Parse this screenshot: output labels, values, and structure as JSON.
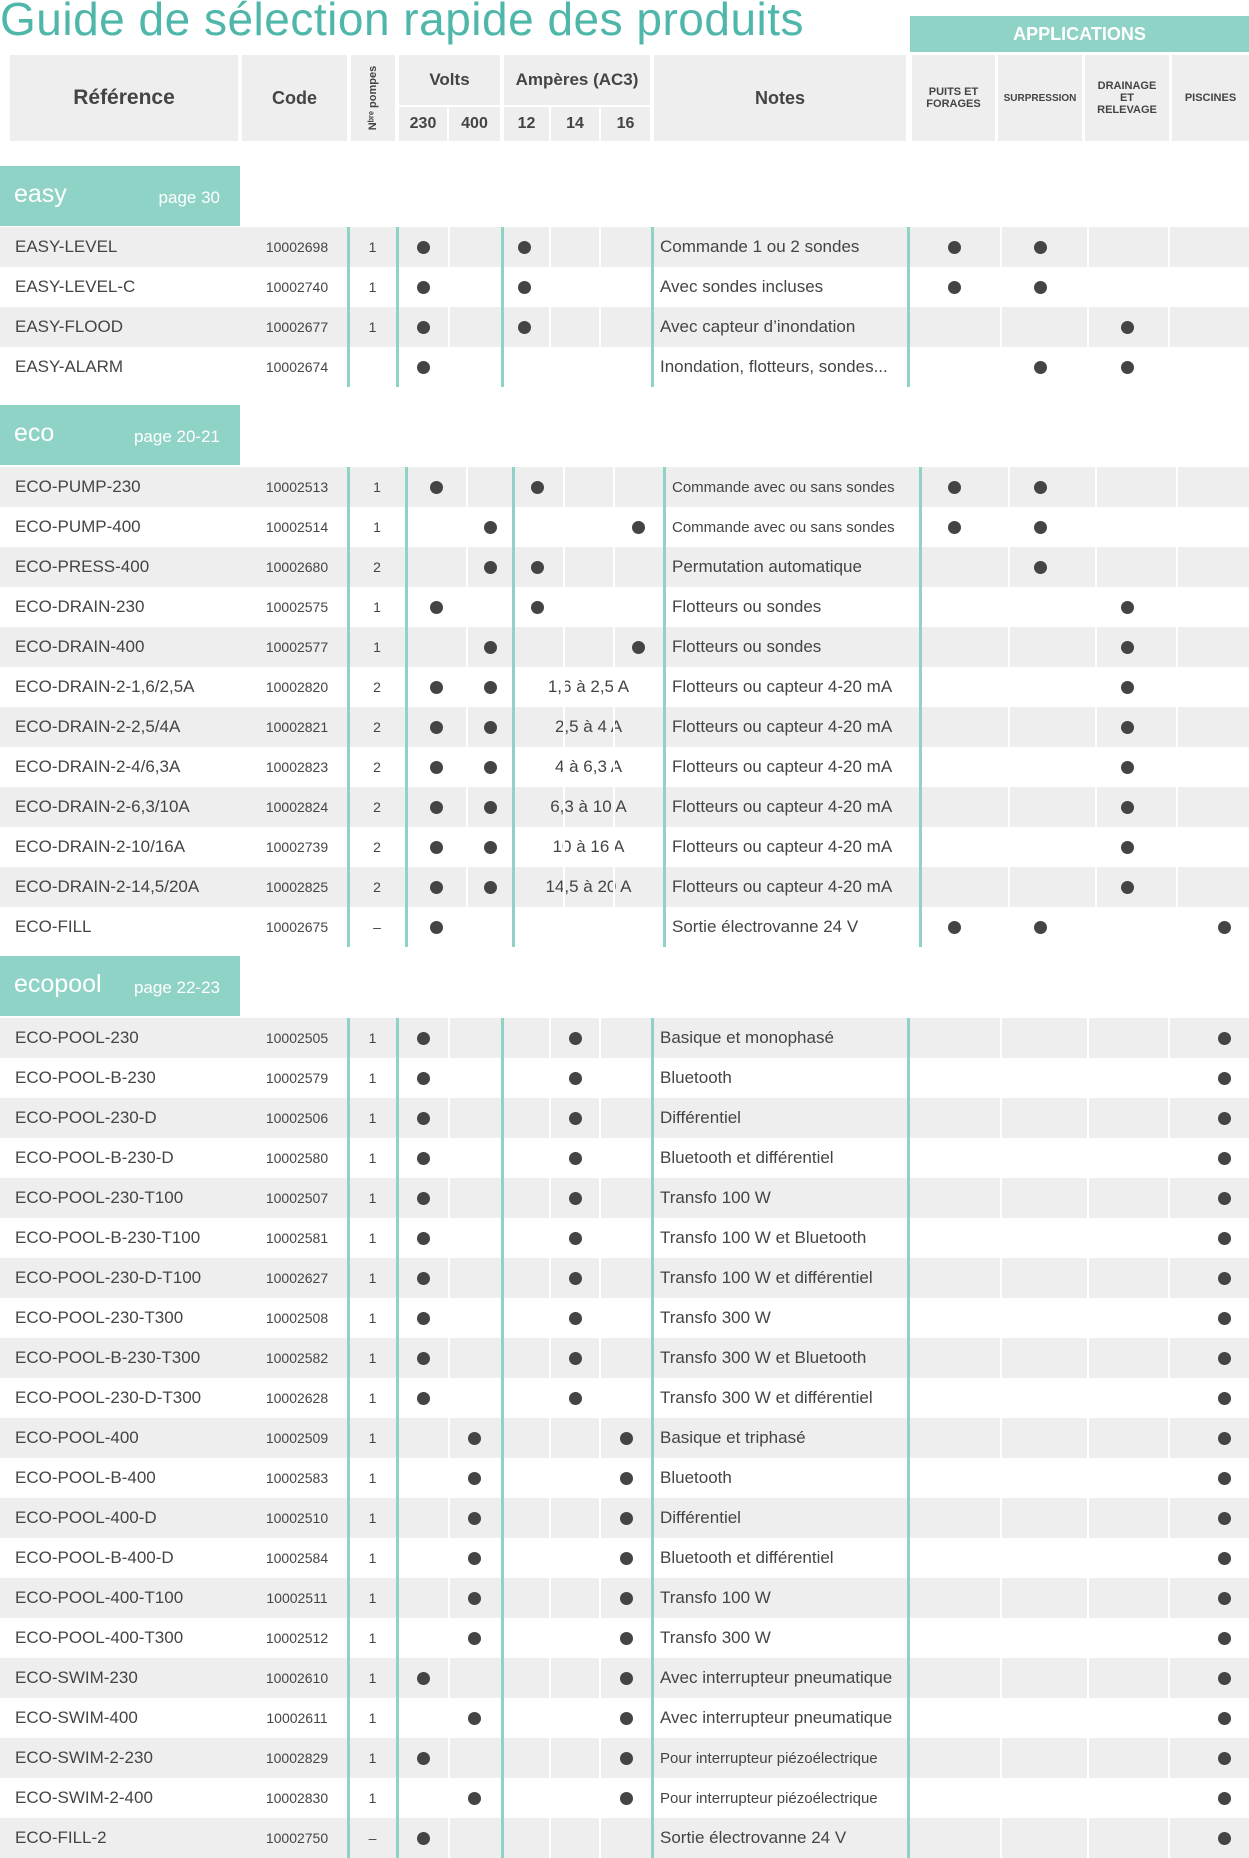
{
  "title": "Guide de sélection rapide des produits",
  "applications_label": "APPLICATIONS",
  "header": {
    "reference": "Référence",
    "code": "Code",
    "pumps": "Nᵇʳᵉ pompes",
    "volts": "Volts",
    "volts_230": "230",
    "volts_400": "400",
    "amperes": "Ampères (AC3)",
    "amp_12": "12",
    "amp_14": "14",
    "amp_16": "16",
    "notes": "Notes",
    "app_wells": "PUITS ET FORAGES",
    "app_boost": "SURPRESSION",
    "app_drain": "DRAINAGE ET RELEVAGE",
    "app_pool": "PISCINES"
  },
  "sections": [
    {
      "name": "easy",
      "page": "page 30",
      "rows": [
        {
          "ref": "EASY-LEVEL",
          "code": "10002698",
          "pumps": "1",
          "v230": true,
          "v400": false,
          "a12": true,
          "a14": false,
          "a16": false,
          "amp_range": "",
          "note": "Commande 1 ou 2 sondes",
          "apps": [
            true,
            true,
            false,
            false
          ]
        },
        {
          "ref": "EASY-LEVEL-C",
          "code": "10002740",
          "pumps": "1",
          "v230": true,
          "v400": false,
          "a12": true,
          "a14": false,
          "a16": false,
          "amp_range": "",
          "note": "Avec sondes incluses",
          "apps": [
            true,
            true,
            false,
            false
          ]
        },
        {
          "ref": "EASY-FLOOD",
          "code": "10002677",
          "pumps": "1",
          "v230": true,
          "v400": false,
          "a12": true,
          "a14": false,
          "a16": false,
          "amp_range": "",
          "note": "Avec capteur d’inondation",
          "apps": [
            false,
            false,
            true,
            false
          ]
        },
        {
          "ref": "EASY-ALARM",
          "code": "10002674",
          "pumps": "",
          "v230": true,
          "v400": false,
          "a12": false,
          "a14": false,
          "a16": false,
          "amp_range": "",
          "note": "Inondation, flotteurs, sondes...",
          "apps": [
            false,
            true,
            true,
            false
          ]
        }
      ]
    },
    {
      "name": "eco",
      "page": "page 20-21",
      "rows": [
        {
          "ref": "ECO-PUMP-230",
          "code": "10002513",
          "pumps": "1",
          "v230": true,
          "v400": false,
          "a12": true,
          "a14": false,
          "a16": false,
          "amp_range": "",
          "note": "Commande avec ou sans sondes",
          "note_small": true,
          "apps": [
            true,
            true,
            false,
            false
          ]
        },
        {
          "ref": "ECO-PUMP-400",
          "code": "10002514",
          "pumps": "1",
          "v230": false,
          "v400": true,
          "a12": false,
          "a14": false,
          "a16": true,
          "amp_range": "",
          "note": "Commande avec ou sans sondes",
          "note_small": true,
          "apps": [
            true,
            true,
            false,
            false
          ]
        },
        {
          "ref": "ECO-PRESS-400",
          "code": "10002680",
          "pumps": "2",
          "v230": false,
          "v400": true,
          "a12": true,
          "a14": false,
          "a16": false,
          "amp_range": "",
          "note": "Permutation automatique",
          "apps": [
            false,
            true,
            false,
            false
          ]
        },
        {
          "ref": "ECO-DRAIN-230",
          "code": "10002575",
          "pumps": "1",
          "v230": true,
          "v400": false,
          "a12": true,
          "a14": false,
          "a16": false,
          "amp_range": "",
          "note": "Flotteurs ou sondes",
          "apps": [
            false,
            false,
            true,
            false
          ]
        },
        {
          "ref": "ECO-DRAIN-400",
          "code": "10002577",
          "pumps": "1",
          "v230": false,
          "v400": true,
          "a12": false,
          "a14": false,
          "a16": true,
          "amp_range": "",
          "note": "Flotteurs ou sondes",
          "apps": [
            false,
            false,
            true,
            false
          ]
        },
        {
          "ref": "ECO-DRAIN-2-1,6/2,5A",
          "code": "10002820",
          "pumps": "2",
          "v230": true,
          "v400": true,
          "a12": false,
          "a14": false,
          "a16": false,
          "amp_range": "1,6 à 2,5 A",
          "note": "Flotteurs ou capteur 4-20 mA",
          "apps": [
            false,
            false,
            true,
            false
          ]
        },
        {
          "ref": "ECO-DRAIN-2-2,5/4A",
          "code": "10002821",
          "pumps": "2",
          "v230": true,
          "v400": true,
          "a12": false,
          "a14": false,
          "a16": false,
          "amp_range": "2,5 à 4 A",
          "note": "Flotteurs ou capteur 4-20 mA",
          "apps": [
            false,
            false,
            true,
            false
          ]
        },
        {
          "ref": "ECO-DRAIN-2-4/6,3A",
          "code": "10002823",
          "pumps": "2",
          "v230": true,
          "v400": true,
          "a12": false,
          "a14": false,
          "a16": false,
          "amp_range": "4 à 6,3 A",
          "note": "Flotteurs ou capteur 4-20 mA",
          "apps": [
            false,
            false,
            true,
            false
          ]
        },
        {
          "ref": "ECO-DRAIN-2-6,3/10A",
          "code": "10002824",
          "pumps": "2",
          "v230": true,
          "v400": true,
          "a12": false,
          "a14": false,
          "a16": false,
          "amp_range": "6,3 à 10 A",
          "note": "Flotteurs ou capteur 4-20 mA",
          "apps": [
            false,
            false,
            true,
            false
          ]
        },
        {
          "ref": "ECO-DRAIN-2-10/16A",
          "code": "10002739",
          "pumps": "2",
          "v230": true,
          "v400": true,
          "a12": false,
          "a14": false,
          "a16": false,
          "amp_range": "10 à 16 A",
          "note": "Flotteurs ou capteur 4-20 mA",
          "apps": [
            false,
            false,
            true,
            false
          ]
        },
        {
          "ref": "ECO-DRAIN-2-14,5/20A",
          "code": "10002825",
          "pumps": "2",
          "v230": true,
          "v400": true,
          "a12": false,
          "a14": false,
          "a16": false,
          "amp_range": "14,5 à 20 A",
          "note": "Flotteurs ou capteur 4-20 mA",
          "apps": [
            false,
            false,
            true,
            false
          ]
        },
        {
          "ref": "ECO-FILL",
          "code": "10002675",
          "pumps": "–",
          "v230": true,
          "v400": false,
          "a12": false,
          "a14": false,
          "a16": false,
          "amp_range": "",
          "note": "Sortie électrovanne 24 V",
          "apps": [
            true,
            true,
            false,
            true
          ]
        }
      ]
    },
    {
      "name": "ecopool",
      "page": "page 22-23",
      "rows": [
        {
          "ref": "ECO-POOL-230",
          "code": "10002505",
          "pumps": "1",
          "v230": true,
          "v400": false,
          "a12": false,
          "a14": true,
          "a16": false,
          "amp_range": "",
          "note": "Basique et monophasé",
          "apps": [
            false,
            false,
            false,
            true
          ]
        },
        {
          "ref": "ECO-POOL-B-230",
          "code": "10002579",
          "pumps": "1",
          "v230": true,
          "v400": false,
          "a12": false,
          "a14": true,
          "a16": false,
          "amp_range": "",
          "note": "Bluetooth",
          "apps": [
            false,
            false,
            false,
            true
          ]
        },
        {
          "ref": "ECO-POOL-230-D",
          "code": "10002506",
          "pumps": "1",
          "v230": true,
          "v400": false,
          "a12": false,
          "a14": true,
          "a16": false,
          "amp_range": "",
          "note": "Différentiel",
          "apps": [
            false,
            false,
            false,
            true
          ]
        },
        {
          "ref": "ECO-POOL-B-230-D",
          "code": "10002580",
          "pumps": "1",
          "v230": true,
          "v400": false,
          "a12": false,
          "a14": true,
          "a16": false,
          "amp_range": "",
          "note": "Bluetooth et différentiel",
          "apps": [
            false,
            false,
            false,
            true
          ]
        },
        {
          "ref": "ECO-POOL-230-T100",
          "code": "10002507",
          "pumps": "1",
          "v230": true,
          "v400": false,
          "a12": false,
          "a14": true,
          "a16": false,
          "amp_range": "",
          "note": "Transfo 100 W",
          "apps": [
            false,
            false,
            false,
            true
          ]
        },
        {
          "ref": "ECO-POOL-B-230-T100",
          "code": "10002581",
          "pumps": "1",
          "v230": true,
          "v400": false,
          "a12": false,
          "a14": true,
          "a16": false,
          "amp_range": "",
          "note": "Transfo 100 W et Bluetooth",
          "apps": [
            false,
            false,
            false,
            true
          ]
        },
        {
          "ref": "ECO-POOL-230-D-T100",
          "code": "10002627",
          "pumps": "1",
          "v230": true,
          "v400": false,
          "a12": false,
          "a14": true,
          "a16": false,
          "amp_range": "",
          "note": "Transfo 100 W et différentiel",
          "apps": [
            false,
            false,
            false,
            true
          ]
        },
        {
          "ref": "ECO-POOL-230-T300",
          "code": "10002508",
          "pumps": "1",
          "v230": true,
          "v400": false,
          "a12": false,
          "a14": true,
          "a16": false,
          "amp_range": "",
          "note": "Transfo 300 W",
          "apps": [
            false,
            false,
            false,
            true
          ]
        },
        {
          "ref": "ECO-POOL-B-230-T300",
          "code": "10002582",
          "pumps": "1",
          "v230": true,
          "v400": false,
          "a12": false,
          "a14": true,
          "a16": false,
          "amp_range": "",
          "note": "Transfo 300 W et Bluetooth",
          "apps": [
            false,
            false,
            false,
            true
          ]
        },
        {
          "ref": "ECO-POOL-230-D-T300",
          "code": "10002628",
          "pumps": "1",
          "v230": true,
          "v400": false,
          "a12": false,
          "a14": true,
          "a16": false,
          "amp_range": "",
          "note": "Transfo 300 W et différentiel",
          "apps": [
            false,
            false,
            false,
            true
          ]
        },
        {
          "ref": "ECO-POOL-400",
          "code": "10002509",
          "pumps": "1",
          "v230": false,
          "v400": true,
          "a12": false,
          "a14": false,
          "a16": true,
          "amp_range": "",
          "note": "Basique et triphasé",
          "apps": [
            false,
            false,
            false,
            true
          ]
        },
        {
          "ref": "ECO-POOL-B-400",
          "code": "10002583",
          "pumps": "1",
          "v230": false,
          "v400": true,
          "a12": false,
          "a14": false,
          "a16": true,
          "amp_range": "",
          "note": "Bluetooth",
          "apps": [
            false,
            false,
            false,
            true
          ]
        },
        {
          "ref": "ECO-POOL-400-D",
          "code": "10002510",
          "pumps": "1",
          "v230": false,
          "v400": true,
          "a12": false,
          "a14": false,
          "a16": true,
          "amp_range": "",
          "note": "Différentiel",
          "apps": [
            false,
            false,
            false,
            true
          ]
        },
        {
          "ref": "ECO-POOL-B-400-D",
          "code": "10002584",
          "pumps": "1",
          "v230": false,
          "v400": true,
          "a12": false,
          "a14": false,
          "a16": true,
          "amp_range": "",
          "note": "Bluetooth et différentiel",
          "apps": [
            false,
            false,
            false,
            true
          ]
        },
        {
          "ref": "ECO-POOL-400-T100",
          "code": "10002511",
          "pumps": "1",
          "v230": false,
          "v400": true,
          "a12": false,
          "a14": false,
          "a16": true,
          "amp_range": "",
          "note": "Transfo 100 W",
          "apps": [
            false,
            false,
            false,
            true
          ]
        },
        {
          "ref": "ECO-POOL-400-T300",
          "code": "10002512",
          "pumps": "1",
          "v230": false,
          "v400": true,
          "a12": false,
          "a14": false,
          "a16": true,
          "amp_range": "",
          "note": "Transfo 300 W",
          "apps": [
            false,
            false,
            false,
            true
          ]
        },
        {
          "ref": "ECO-SWIM-230",
          "code": "10002610",
          "pumps": "1",
          "v230": true,
          "v400": false,
          "a12": false,
          "a14": false,
          "a16": true,
          "amp_range": "",
          "note": "Avec interrupteur pneumatique",
          "apps": [
            false,
            false,
            false,
            true
          ]
        },
        {
          "ref": "ECO-SWIM-400",
          "code": "10002611",
          "pumps": "1",
          "v230": false,
          "v400": true,
          "a12": false,
          "a14": false,
          "a16": true,
          "amp_range": "",
          "note": "Avec interrupteur pneumatique",
          "apps": [
            false,
            false,
            false,
            true
          ]
        },
        {
          "ref": "ECO-SWIM-2-230",
          "code": "10002829",
          "pumps": "1",
          "v230": true,
          "v400": false,
          "a12": false,
          "a14": false,
          "a16": true,
          "amp_range": "",
          "note": "Pour interrupteur piézoélectrique",
          "note_small": true,
          "apps": [
            false,
            false,
            false,
            true
          ]
        },
        {
          "ref": "ECO-SWIM-2-400",
          "code": "10002830",
          "pumps": "1",
          "v230": false,
          "v400": true,
          "a12": false,
          "a14": false,
          "a16": true,
          "amp_range": "",
          "note": "Pour interrupteur piézoélectrique",
          "note_small": true,
          "apps": [
            false,
            false,
            false,
            true
          ]
        },
        {
          "ref": "ECO-FILL-2",
          "code": "10002750",
          "pumps": "–",
          "v230": true,
          "v400": false,
          "a12": false,
          "a14": false,
          "a16": false,
          "amp_range": "",
          "note": "Sortie électrovanne 24 V",
          "apps": [
            false,
            false,
            false,
            true
          ]
        }
      ]
    }
  ]
}
